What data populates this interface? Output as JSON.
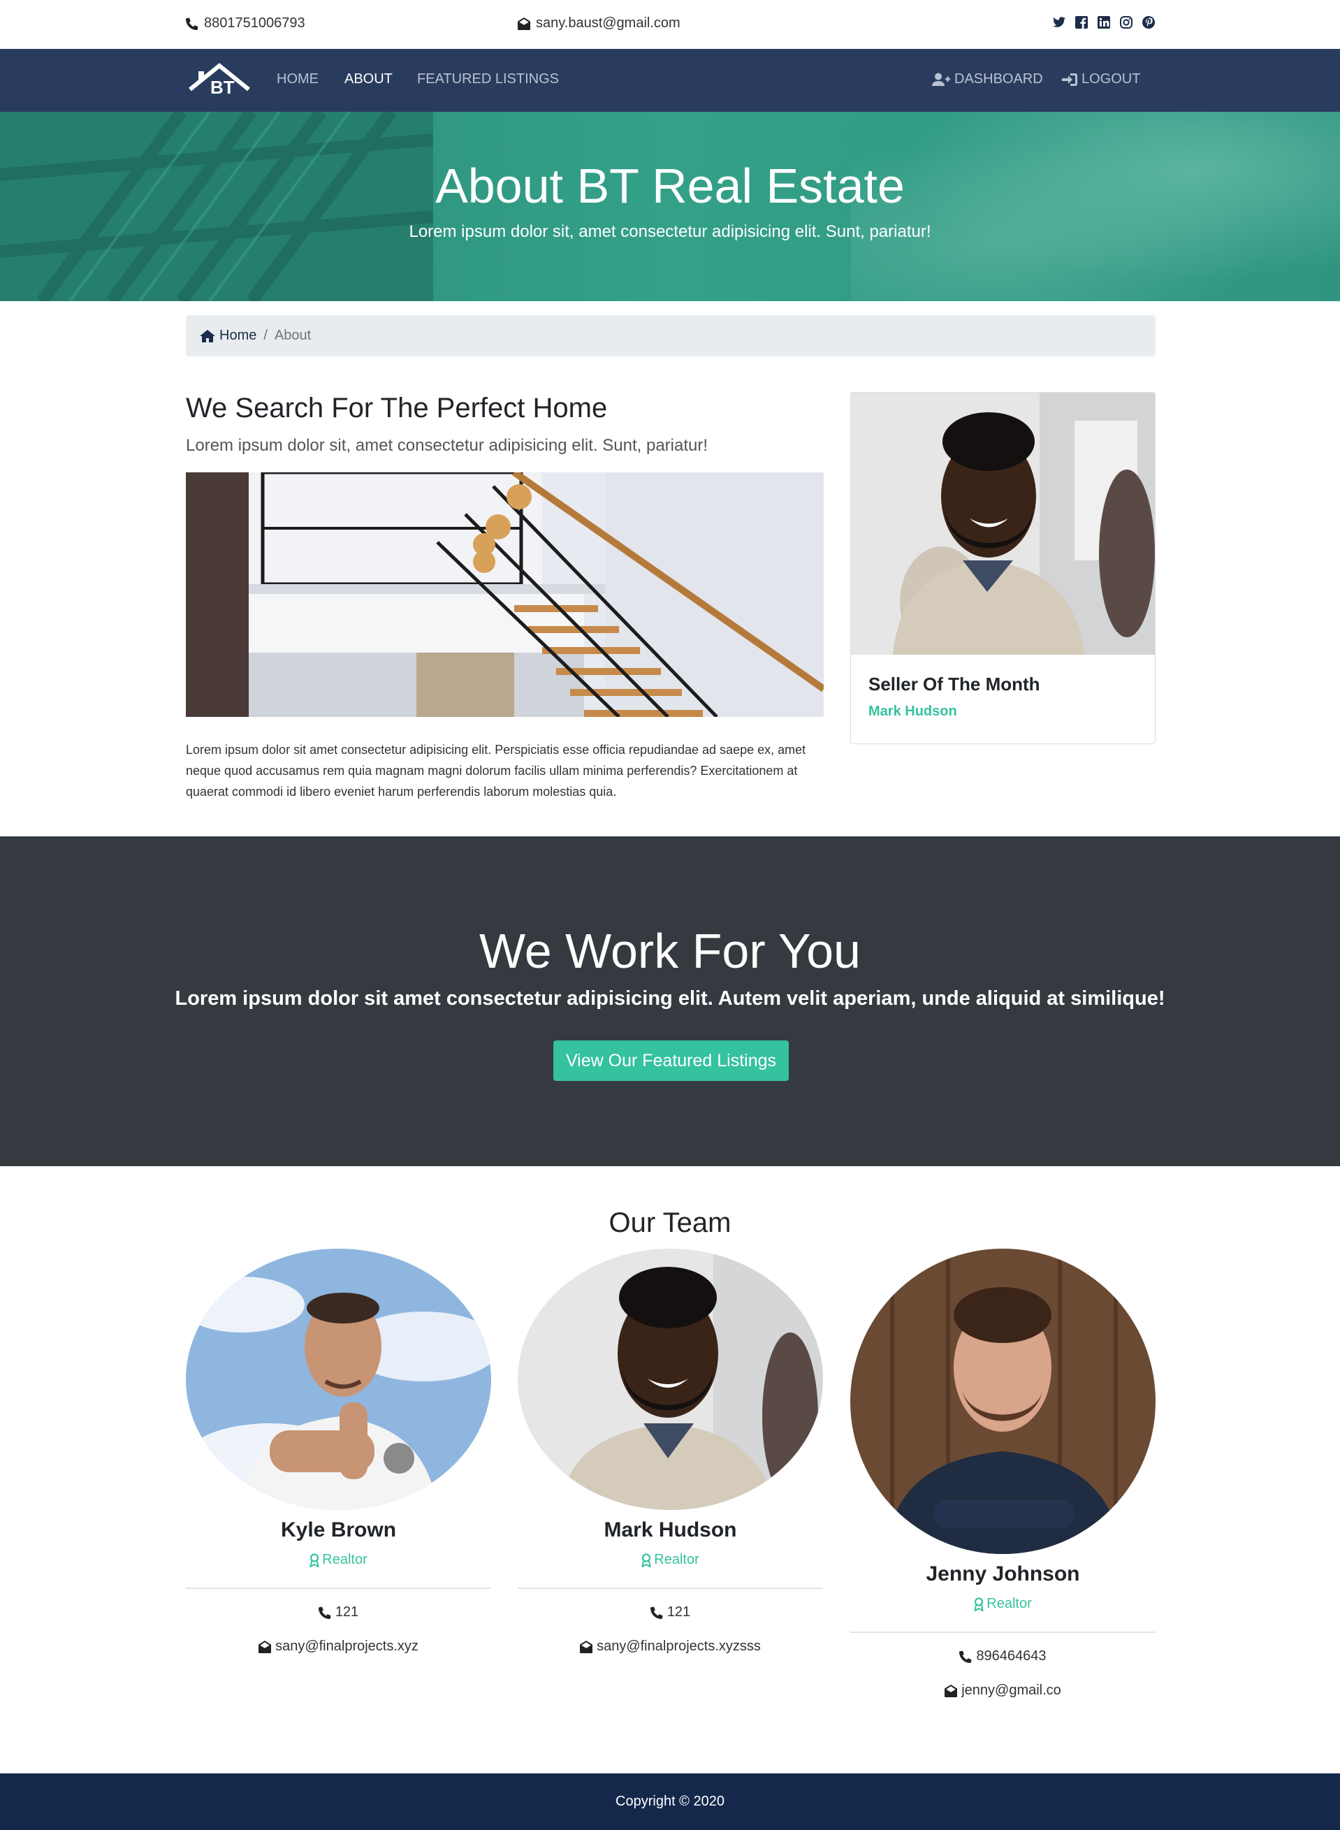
{
  "topbar": {
    "phone": "8801751006793",
    "email": "sany.baust@gmail.com",
    "social_icons": [
      "twitter-icon",
      "facebook-icon",
      "linkedin-icon",
      "instagram-icon",
      "pinterest-icon"
    ]
  },
  "navbar": {
    "logo_text": "BT",
    "links": [
      {
        "label": "HOME",
        "active": false
      },
      {
        "label": "ABOUT",
        "active": true
      },
      {
        "label": "FEATURED LISTINGS",
        "active": false
      }
    ],
    "dashboard_label": "DASHBOARD",
    "logout_label": "LOGOUT"
  },
  "hero": {
    "title": "About BT Real Estate",
    "subtitle": "Lorem ipsum dolor sit, amet consectetur adipisicing elit. Sunt, pariatur!"
  },
  "breadcrumb": {
    "home": "Home",
    "current": "About"
  },
  "about": {
    "title": "We Search For The Perfect Home",
    "lead": "Lorem ipsum dolor sit, amet consectetur adipisicing elit. Sunt, pariatur!",
    "body": "Lorem ipsum dolor sit amet consectetur adipisicing elit. Perspiciatis esse officia repudiandae ad saepe ex, amet neque quod accusamus rem quia magnam magni dolorum facilis ullam minima perferendis? Exercitationem at quaerat commodi id libero eveniet harum perferendis laborum molestias quia."
  },
  "seller": {
    "title": "Seller Of The Month",
    "name": "Mark Hudson"
  },
  "cta": {
    "title": "We Work For You",
    "subtitle": "Lorem ipsum dolor sit amet consectetur adipisicing elit. Autem velit aperiam, unde aliquid at similique!",
    "button": "View Our Featured Listings"
  },
  "team": {
    "title": "Our Team",
    "members": [
      {
        "name": "Kyle Brown",
        "role": "Realtor",
        "phone": "121",
        "email": "sany@finalprojects.xyz"
      },
      {
        "name": "Mark Hudson",
        "role": "Realtor",
        "phone": "121",
        "email": "sany@finalprojects.xyzsss"
      },
      {
        "name": "Jenny Johnson",
        "role": "Realtor",
        "phone": "896464643",
        "email": "jenny@gmail.co"
      }
    ]
  },
  "footer": {
    "copyright": "Copyright © 2020"
  },
  "colors": {
    "navbar": "#2a3c5e",
    "accent": "#35c29e",
    "dark_section": "#343a40",
    "footer": "#14284c"
  }
}
